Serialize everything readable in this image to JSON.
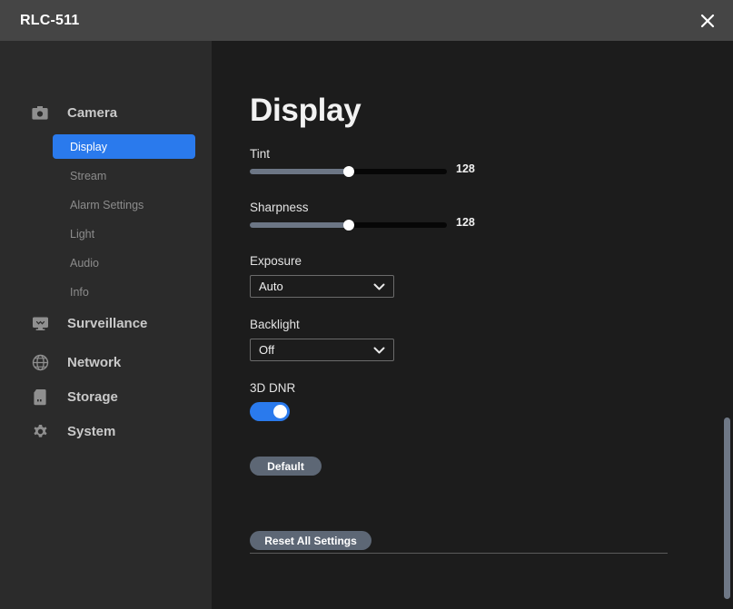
{
  "window": {
    "title": "RLC-511",
    "close_icon": "close-icon"
  },
  "sidebar": {
    "groups": [
      {
        "label": "Camera",
        "icon": "camera-icon",
        "items": [
          {
            "label": "Display",
            "active": true
          },
          {
            "label": "Stream",
            "active": false
          },
          {
            "label": "Alarm Settings",
            "active": false
          },
          {
            "label": "Light",
            "active": false
          },
          {
            "label": "Audio",
            "active": false
          },
          {
            "label": "Info",
            "active": false
          }
        ]
      },
      {
        "label": "Surveillance",
        "icon": "monitor-icon",
        "items": []
      },
      {
        "label": "Network",
        "icon": "globe-icon",
        "items": []
      },
      {
        "label": "Storage",
        "icon": "sdcard-icon",
        "items": []
      },
      {
        "label": "System",
        "icon": "gear-icon",
        "items": []
      }
    ]
  },
  "main": {
    "page_title": "Display",
    "sliders": [
      {
        "label": "Tint",
        "value": "128",
        "percent": 50
      },
      {
        "label": "Sharpness",
        "value": "128",
        "percent": 50
      }
    ],
    "selects": [
      {
        "label": "Exposure",
        "value": "Auto"
      },
      {
        "label": "Backlight",
        "value": "Off"
      }
    ],
    "toggle": {
      "label": "3D DNR",
      "state_on": true
    },
    "default_button": "Default",
    "reset_button": "Reset All Settings"
  },
  "colors": {
    "accent": "#2a7aed",
    "titlebar": "#454545",
    "sidebar": "#2b2b2b",
    "content": "#1c1c1c",
    "button": "#5d6775",
    "slider_fill": "#6c7685",
    "scrollbar": "#6f7886"
  }
}
